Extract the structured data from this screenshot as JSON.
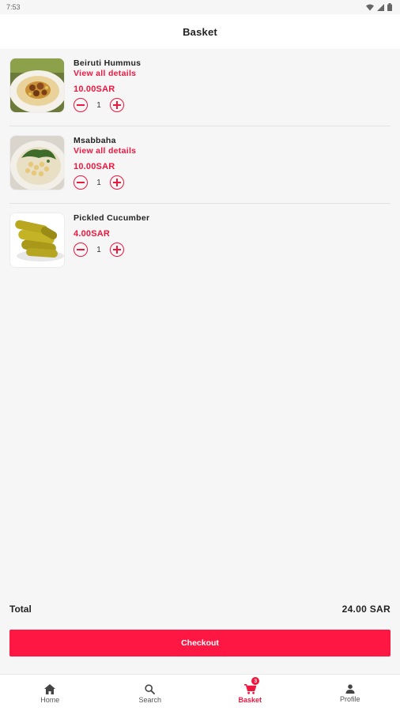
{
  "status": {
    "time": "7:53"
  },
  "app_bar": {
    "title": "Basket"
  },
  "items": [
    {
      "name": "Beiruti Hummus",
      "details_link": "View all details",
      "price": "10.00SAR",
      "quantity": "1",
      "image": "hummus-image"
    },
    {
      "name": "Msabbaha",
      "details_link": "View all details",
      "price": "10.00SAR",
      "quantity": "1",
      "image": "msabbaha-image"
    },
    {
      "name": "Pickled Cucumber",
      "price": "4.00SAR",
      "quantity": "1",
      "image": "pickled-cucumber-image"
    }
  ],
  "summary": {
    "total_label": "Total",
    "total_value": "24.00 SAR"
  },
  "checkout": {
    "label": "Checkout"
  },
  "nav": {
    "items": [
      {
        "label": "Home",
        "icon": "home-icon"
      },
      {
        "label": "Search",
        "icon": "search-icon"
      },
      {
        "label": "Basket",
        "icon": "cart-icon",
        "badge": "3",
        "active": true
      },
      {
        "label": "Profile",
        "icon": "person-icon"
      }
    ]
  },
  "colors": {
    "accent": "#f0173f",
    "checkout": "#ff1744",
    "background": "#f6f6f6"
  }
}
